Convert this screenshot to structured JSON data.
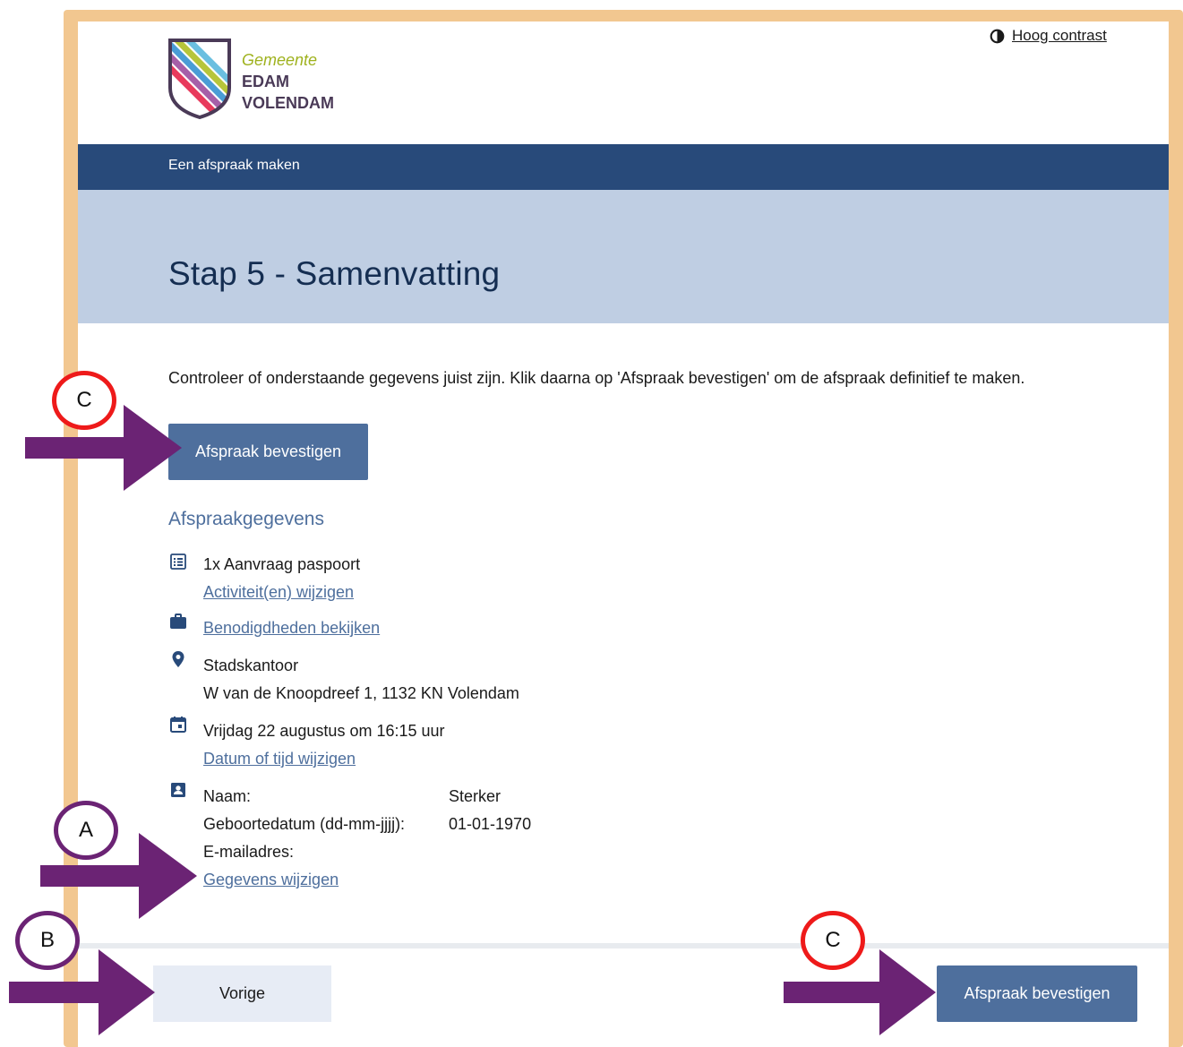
{
  "header": {
    "logo_line1": "Gemeente",
    "logo_line2": "EDAM",
    "logo_line3": "VOLENDAM",
    "contrast_label": "Hoog contrast",
    "contrast_icon": "half-circle-icon"
  },
  "nav": {
    "title": "Een afspraak maken"
  },
  "page": {
    "title": "Stap 5 - Samenvatting",
    "intro": "Controleer of onderstaande gegevens juist zijn. Klik daarna op 'Afspraak bevestigen' om de afspraak definitief te maken.",
    "confirm_label": "Afspraak bevestigen",
    "section_title": "Afspraakgegevens"
  },
  "details": {
    "activity": "1x Aanvraag paspoort",
    "activity_link": "Activiteit(en) wijzigen",
    "requirements_link": "Benodigdheden bekijken",
    "location_name": "Stadskantoor",
    "location_address": "W van de Knoopdreef 1, 1132 KN Volendam",
    "datetime": "Vrijdag 22 augustus om 16:15 uur",
    "datetime_link": "Datum of tijd wijzigen",
    "person": {
      "name_label": "Naam:",
      "name_value": "Sterker",
      "dob_label": "Geboortedatum (dd-mm-jjjj):",
      "dob_value": "01-01-1970",
      "email_label": "E-mailadres:",
      "email_value": ""
    },
    "person_link": "Gegevens wijzigen"
  },
  "footer": {
    "back_label": "Vorige",
    "confirm_label": "Afspraak bevestigen"
  },
  "annotations": {
    "top_marker": "C",
    "a_marker": "A",
    "b_marker": "B",
    "bottom_marker": "C",
    "red_color": "#ee1a1a",
    "purple_color": "#6b2374"
  },
  "colors": {
    "navbar": "#284a7a",
    "title_band": "#bfcee3",
    "primary_button": "#4e6f9d",
    "frame": "#f2c790"
  }
}
